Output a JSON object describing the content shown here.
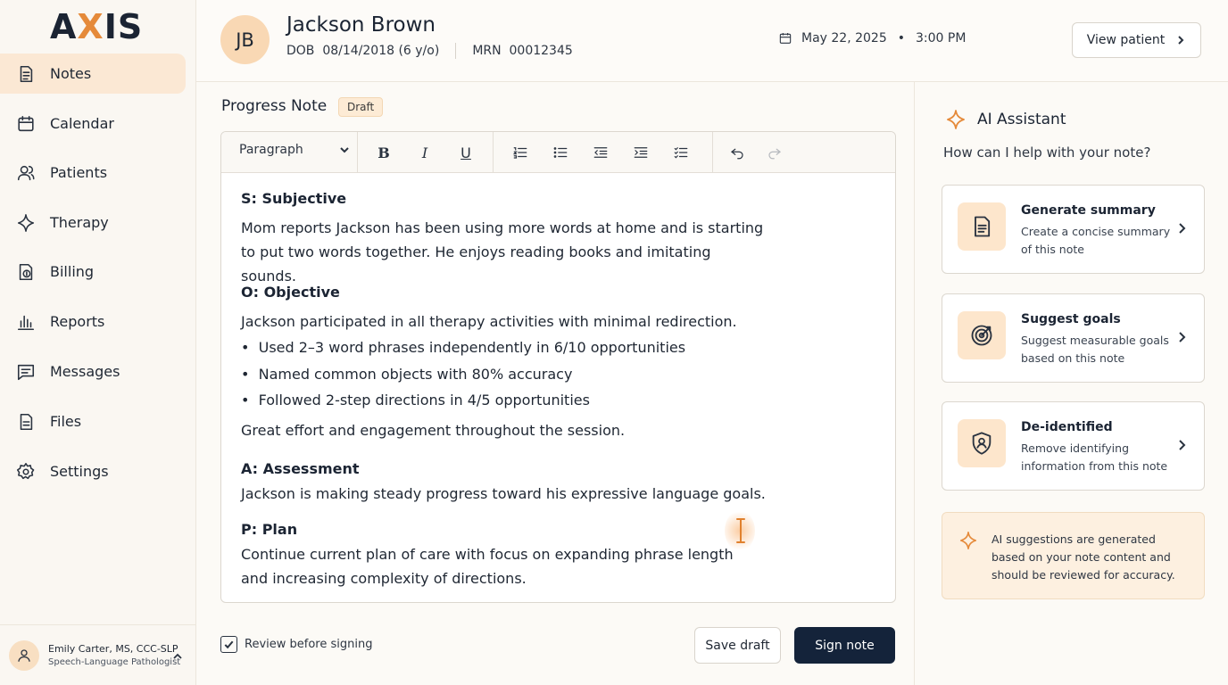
{
  "app": {
    "logo_a": "A",
    "logo_x": "X",
    "logo_is": "IS"
  },
  "sidebar": {
    "items": [
      {
        "label": "Notes",
        "icon": "notes-icon"
      },
      {
        "label": "Calendar",
        "icon": "calendar-icon"
      },
      {
        "label": "Patients",
        "icon": "patients-icon"
      },
      {
        "label": "Therapy",
        "icon": "therapy-icon"
      },
      {
        "label": "Billing",
        "icon": "billing-icon"
      },
      {
        "label": "Reports",
        "icon": "reports-icon"
      },
      {
        "label": "Messages",
        "icon": "messages-icon"
      },
      {
        "label": "Files",
        "icon": "files-icon"
      },
      {
        "label": "Settings",
        "icon": "settings-icon"
      }
    ],
    "active": "Notes",
    "user": {
      "name": "Emily Carter, MS, CCC-SLP",
      "role": "Speech-Language Pathologist"
    }
  },
  "header": {
    "initials": "JB",
    "patient_name": "Jackson Brown",
    "dob_label": "DOB",
    "dob_value": "08/14/2018 (6 y/o)",
    "mrn_label": "MRN",
    "mrn_value": "00012345",
    "date": "May 22, 2025",
    "dot": "•",
    "time": "3:00 PM",
    "view_patient": "View patient"
  },
  "note": {
    "title": "Progress Note",
    "status": "Draft",
    "toolbar": {
      "paragraph": "Paragraph",
      "bold": "B",
      "italic": "I",
      "underline": "U"
    },
    "subjective_head": "S: Subjective",
    "subjective_text": "Mom reports Jackson has been using more words at home and is starting to put two words together. He enjoys reading books and imitating sounds.",
    "objective_head": "O: Objective",
    "objective_intro": "Jackson participated in all therapy activities with minimal redirection.",
    "objective_bullets": [
      "Used 2–3 word phrases independently in 6/10 opportunities",
      "Named common objects with 80% accuracy",
      "Followed 2-step directions in 4/5 opportunities"
    ],
    "objective_outro": "Great effort and engagement throughout the session.",
    "assessment_head": "A: Assessment",
    "assessment_text": "Jackson is making steady progress toward his expressive language goals.",
    "plan_head": "P: Plan",
    "plan_text": "Continue current plan of care with focus on expanding phrase length and increasing complexity of directions."
  },
  "actions": {
    "review_label": "Review before signing",
    "review_checked": true,
    "save_draft": "Save draft",
    "sign_note": "Sign note"
  },
  "ai": {
    "title": "AI Assistant",
    "subtitle": "How can I help with your note?",
    "cards": [
      {
        "title": "Generate summary",
        "desc": "Create a concise summary of this note",
        "icon": "document-icon"
      },
      {
        "title": "Suggest goals",
        "desc": "Suggest measurable goals based on this note",
        "icon": "target-icon"
      },
      {
        "title": "De-identified",
        "desc": "Remove identifying information from this note",
        "icon": "shield-icon"
      }
    ],
    "disclaimer": "AI suggestions are generated based on your note content and should be reviewed for accuracy."
  },
  "colors": {
    "accent": "#e58a3a",
    "active_nav": "#fbe8d4",
    "primary_button": "#14233a",
    "ai_card_icon_bg": "#fde6cc"
  }
}
